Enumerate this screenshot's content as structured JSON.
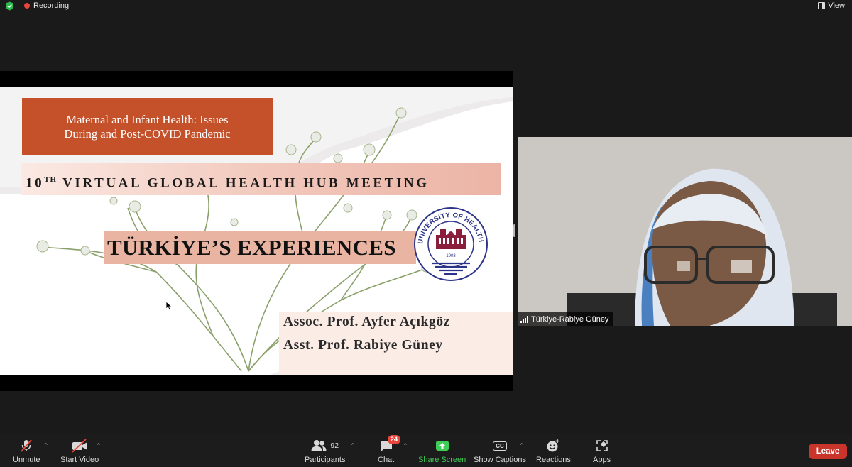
{
  "top_bar": {
    "recording_label": "Recording",
    "view_label": "View"
  },
  "slide": {
    "title_line1": "Maternal and Infant Health: Issues",
    "title_line2": "During and Post-COVID Pandemic",
    "meeting_num": "10",
    "meeting_sup": "TH",
    "meeting_rest": " VIRTUAL GLOBAL HEALTH HUB MEETING",
    "experiences": "TÜRKİYE’S EXPERIENCES",
    "logo_text": "UNIVERSITY OF HEALTH SCIENCES",
    "logo_year": "1903",
    "authors": [
      "Assoc. Prof. Ayfer Açıkgöz",
      "Asst. Prof. Rabiye Güney"
    ]
  },
  "participant": {
    "name": "Türkiye-Rabiye Güney"
  },
  "toolbar": {
    "unmute": "Unmute",
    "start_video": "Start Video",
    "participants": "Participants",
    "participants_count": "92",
    "chat": "Chat",
    "chat_badge": "24",
    "share_screen": "Share Screen",
    "show_captions": "Show Captions",
    "cc_icon_text": "CC",
    "reactions": "Reactions",
    "apps": "Apps",
    "leave": "Leave"
  },
  "colors": {
    "accent_green": "#3fce55",
    "leave_red": "#c9342b",
    "slide_title_bg": "#c4512a"
  }
}
